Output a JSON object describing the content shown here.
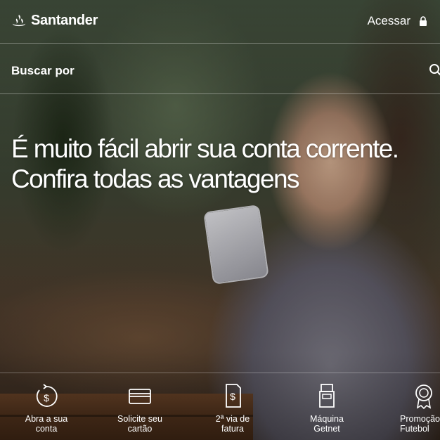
{
  "header": {
    "brand": "Santander",
    "login_label": "Acessar"
  },
  "search": {
    "label": "Buscar por"
  },
  "hero": {
    "headline_line1": "É muito fácil abrir sua conta corrente.",
    "headline_line2": "Confira todas as vantagens"
  },
  "quick_links": [
    {
      "line1": "Abra a sua",
      "line2": "conta",
      "icon": "dollar-refresh-icon"
    },
    {
      "line1": "Solicite seu",
      "line2": "cartão",
      "icon": "card-icon"
    },
    {
      "line1": "2ª via de",
      "line2": "fatura",
      "icon": "invoice-icon"
    },
    {
      "line1": "Máquina",
      "line2": "Getnet",
      "icon": "card-machine-icon"
    },
    {
      "line1": "Promoção",
      "line2": "Futebol",
      "icon": "award-medal-icon"
    }
  ],
  "colors": {
    "text": "#ffffff",
    "brand_red": "#ec0000"
  }
}
